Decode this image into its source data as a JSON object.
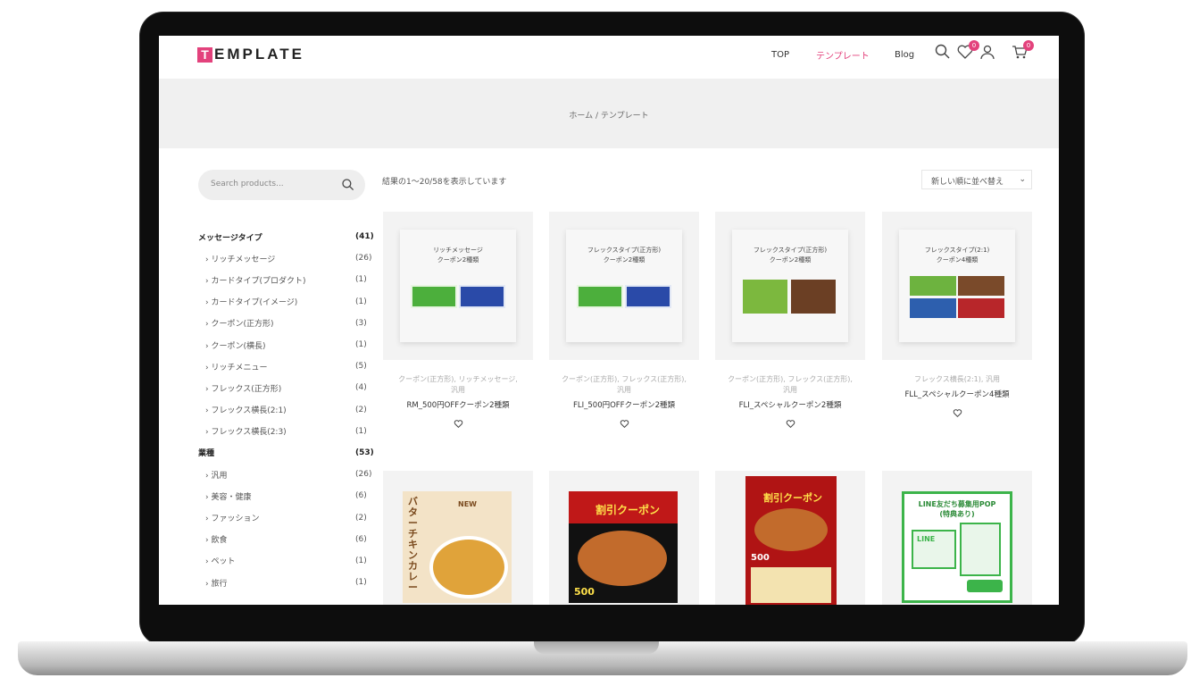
{
  "header": {
    "logo_letter": "T",
    "logo_rest": "EMPLATE",
    "nav": [
      "TOP",
      "テンプレート",
      "Blog"
    ],
    "wishlist_count": "0",
    "cart_count": "0"
  },
  "breadcrumb": "ホーム / テンプレート",
  "search": {
    "placeholder": "Search products..."
  },
  "result_count": "結果の1～20/58を表示しています",
  "sort": {
    "selected": "新しい順に並べ替え"
  },
  "categories": [
    {
      "label": "メッセージタイプ",
      "count": "(41)",
      "level": "head"
    },
    {
      "label": "› リッチメッセージ",
      "count": "(26)",
      "level": "sub"
    },
    {
      "label": "› カードタイプ(プロダクト)",
      "count": "(1)",
      "level": "sub"
    },
    {
      "label": "› カードタイプ(イメージ)",
      "count": "(1)",
      "level": "sub"
    },
    {
      "label": "› クーポン(正方形)",
      "count": "(3)",
      "level": "sub"
    },
    {
      "label": "› クーポン(横長)",
      "count": "(1)",
      "level": "sub"
    },
    {
      "label": "› リッチメニュー",
      "count": "(5)",
      "level": "sub"
    },
    {
      "label": "› フレックス(正方形)",
      "count": "(4)",
      "level": "sub"
    },
    {
      "label": "› フレックス横長(2:1)",
      "count": "(2)",
      "level": "sub"
    },
    {
      "label": "› フレックス横長(2:3)",
      "count": "(1)",
      "level": "sub"
    },
    {
      "label": "業種",
      "count": "(53)",
      "level": "head"
    },
    {
      "label": "› 汎用",
      "count": "(26)",
      "level": "sub"
    },
    {
      "label": "› 美容・健康",
      "count": "(6)",
      "level": "sub"
    },
    {
      "label": "› ファッション",
      "count": "(2)",
      "level": "sub"
    },
    {
      "label": "› 飲食",
      "count": "(6)",
      "level": "sub"
    },
    {
      "label": "› ペット",
      "count": "(1)",
      "level": "sub"
    },
    {
      "label": "› 旅行",
      "count": "(1)",
      "level": "sub"
    }
  ],
  "products": [
    {
      "thumb_text": "リッチメッセージ\nクーポン2種類",
      "cats": "クーポン(正方形), リッチメッセージ, 汎用",
      "title": "RM_500円OFFクーポン2種類"
    },
    {
      "thumb_text": "フレックスタイプ(正方形)\nクーポン2種類",
      "cats": "クーポン(正方形), フレックス(正方形), 汎用",
      "title": "FLI_500円OFFクーポン2種類"
    },
    {
      "thumb_text": "フレックスタイプ(正方形)\nクーポン2種類",
      "cats": "クーポン(正方形), フレックス(正方形), 汎用",
      "title": "FLI_スペシャルクーポン2種類"
    },
    {
      "thumb_text": "フレックスタイプ(2:1)\nクーポン4種類",
      "cats": "フレックス横長(2:1), 汎用",
      "title": "FLL_スペシャルクーポン4種類"
    }
  ],
  "posters": [
    {
      "headline": "バターチキンカレー",
      "tag": "NEW"
    },
    {
      "headline": "割引クーポン",
      "price": "500"
    },
    {
      "headline": "割引クーポン",
      "price": "500"
    },
    {
      "headline": "LINE友だち募集用POP\n(特典あり)",
      "tag": "LINE"
    }
  ],
  "colors": {
    "accent": "#e3427c",
    "banner": "#f0f0f0",
    "card_bg": "#f3f3f3"
  }
}
